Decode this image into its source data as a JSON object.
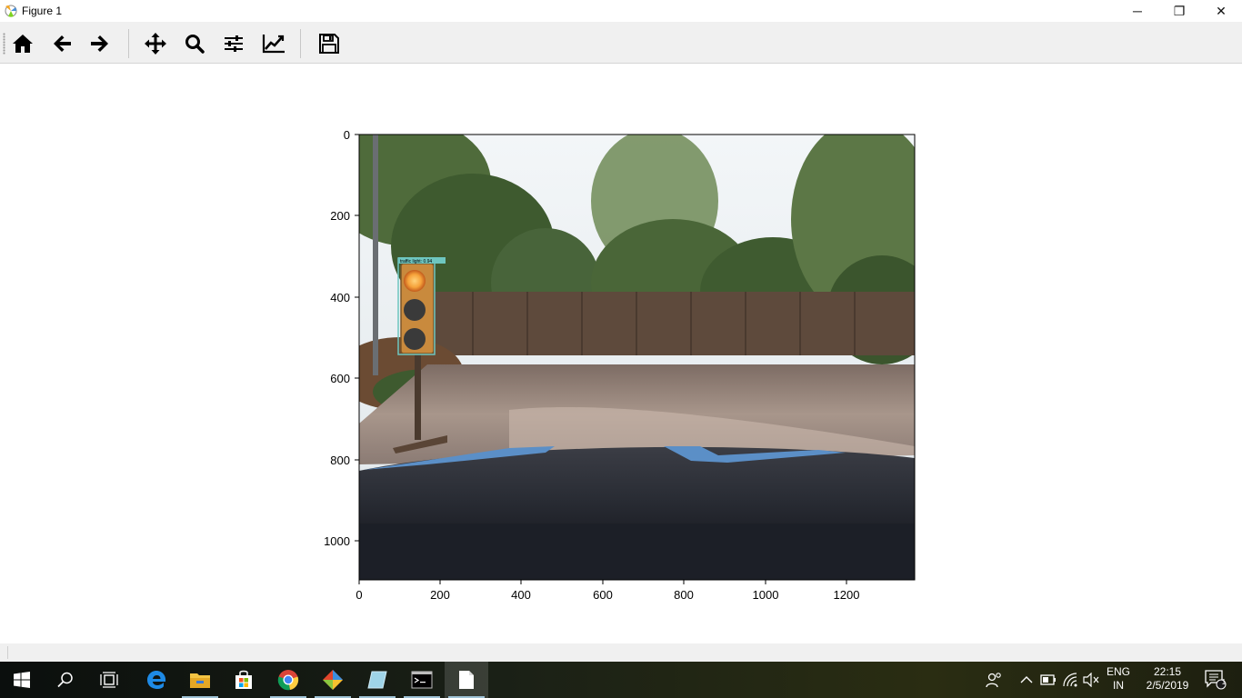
{
  "window": {
    "title": "Figure 1",
    "controls": {
      "minimize": "─",
      "restore": "❐",
      "close": "✕"
    }
  },
  "toolbar": {
    "buttons": [
      {
        "name": "home",
        "icon": "home-icon"
      },
      {
        "name": "back",
        "icon": "arrow-left-icon"
      },
      {
        "name": "forward",
        "icon": "arrow-right-icon"
      },
      {
        "name": "pan",
        "icon": "move-icon"
      },
      {
        "name": "zoom",
        "icon": "search-icon"
      },
      {
        "name": "subplots",
        "icon": "sliders-icon"
      },
      {
        "name": "edit-axis",
        "icon": "line-chart-icon"
      },
      {
        "name": "save",
        "icon": "save-icon"
      }
    ]
  },
  "figure": {
    "image_description_colors": {
      "sky": "#e9eef2",
      "foliage": "#3d5a2e",
      "road": "#8a7a72",
      "hood": "#2a2d34",
      "box": "#6ec6c0"
    },
    "detection_label": "traffic light: 0.94",
    "x_ticks": [
      "0",
      "200",
      "400",
      "600",
      "800",
      "1000",
      "1200"
    ],
    "y_ticks": [
      "0",
      "200",
      "400",
      "600",
      "800",
      "1000"
    ]
  },
  "taskbar": {
    "apps": [
      {
        "name": "start",
        "icon": "windows-icon"
      },
      {
        "name": "search",
        "icon": "search-icon"
      },
      {
        "name": "task-view",
        "icon": "task-view-icon"
      },
      {
        "name": "edge",
        "icon": "edge-icon"
      },
      {
        "name": "file-explorer",
        "icon": "folder-icon"
      },
      {
        "name": "store",
        "icon": "store-icon"
      },
      {
        "name": "chrome",
        "icon": "chrome-icon"
      },
      {
        "name": "git",
        "icon": "git-icon"
      },
      {
        "name": "notepad",
        "icon": "notepad-icon"
      },
      {
        "name": "terminal",
        "icon": "terminal-icon"
      },
      {
        "name": "figure-window",
        "icon": "document-icon"
      }
    ],
    "language": {
      "line1": "ENG",
      "line2": "IN"
    },
    "clock": {
      "time": "22:15",
      "date": "2/5/2019"
    },
    "notification_count": "1"
  }
}
